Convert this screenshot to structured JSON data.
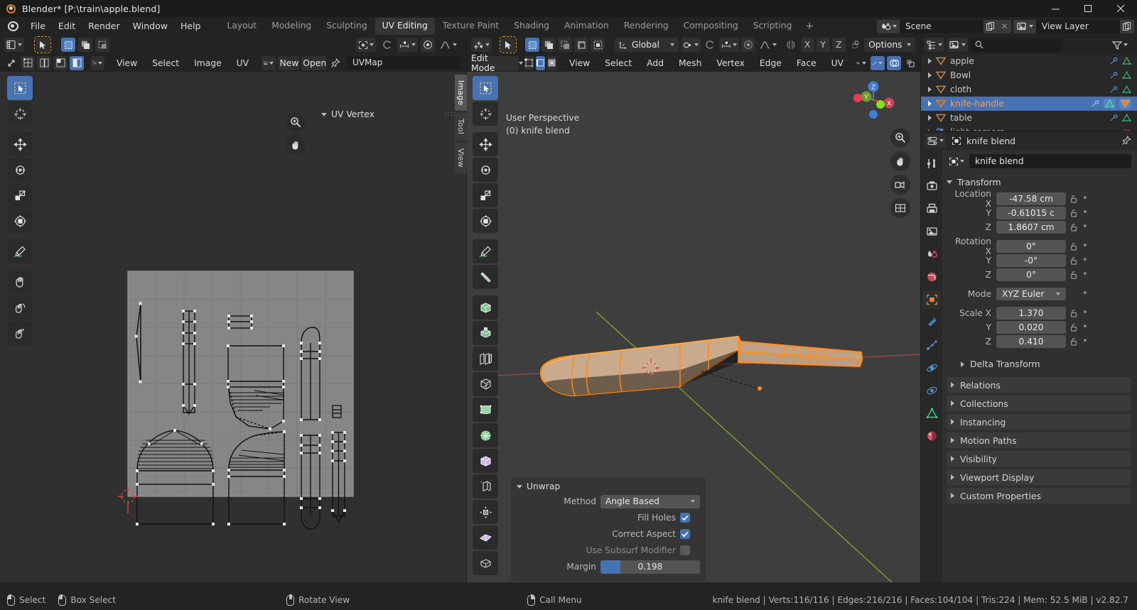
{
  "window": {
    "title": "Blender* [P:\\train\\apple.blend]",
    "icon": "blender-logo-icon",
    "controls": {
      "minimize": "minimize-icon",
      "maximize": "maximize-icon",
      "close": "close-icon"
    }
  },
  "topbar": {
    "menus": [
      "File",
      "Edit",
      "Render",
      "Window",
      "Help"
    ],
    "workspaces": [
      {
        "label": "Layout",
        "active": false
      },
      {
        "label": "Modeling",
        "active": false
      },
      {
        "label": "Sculpting",
        "active": false
      },
      {
        "label": "UV Editing",
        "active": true
      },
      {
        "label": "Texture Paint",
        "active": false
      },
      {
        "label": "Shading",
        "active": false
      },
      {
        "label": "Animation",
        "active": false
      },
      {
        "label": "Rendering",
        "active": false
      },
      {
        "label": "Compositing",
        "active": false
      },
      {
        "label": "Scripting",
        "active": false
      }
    ],
    "add_workspace": "+",
    "scene": {
      "label": "Scene",
      "icon": "scene-icon"
    },
    "view_layer": {
      "label": "View Layer",
      "icon": "view-layer-icon"
    }
  },
  "uv_editor": {
    "menus": [
      "View",
      "Select",
      "Image",
      "UV"
    ],
    "new_button": "New",
    "open_button": "Open",
    "image_name": "UVMap",
    "transform_orientation": "",
    "panel": {
      "title": "UV Vertex"
    },
    "side_tabs": [
      "Image",
      "Tool",
      "View"
    ],
    "tools": [
      "tweak-select-tool",
      "cursor-tool",
      "move-tool",
      "rotate-tool",
      "scale-tool",
      "transform-tool",
      "annotate-tool",
      "grab-uv-tool",
      "relax-uv-tool",
      "pinch-uv-tool"
    ]
  },
  "viewport": {
    "mode": "Edit Mode",
    "menus": [
      "View",
      "Select",
      "Add",
      "Mesh",
      "Vertex",
      "Edge",
      "Face",
      "UV"
    ],
    "transform_orientation": "Global",
    "options_label": "Options",
    "axis_toggles": [
      "X",
      "Y",
      "Z"
    ],
    "overlay_text_1": "User Perspective",
    "overlay_text_2": "(0) knife blend",
    "gizmo_axes": {
      "x": "X",
      "y": "Y",
      "z": "Z"
    },
    "tools": [
      "tweak-select-tool",
      "cursor-tool",
      "move-tool",
      "rotate-tool",
      "scale-tool",
      "transform-tool",
      "annotate-tool",
      "measure-tool",
      "add-cube-tool",
      "extrude-region-tool",
      "inset-faces-tool",
      "bevel-tool",
      "loop-cut-tool",
      "knife-tool",
      "poly-build-tool",
      "spin-tool",
      "smooth-tool",
      "edge-slide-tool",
      "shrink-fatten-tool",
      "shear-tool",
      "rip-region-tool"
    ]
  },
  "operator_panel": {
    "title": "Unwrap",
    "method_label": "Method",
    "method_value": "Angle Based",
    "fill_holes_label": "Fill Holes",
    "fill_holes": true,
    "correct_aspect_label": "Correct Aspect",
    "correct_aspect": true,
    "use_subsurf_label": "Use Subsurf Modifier",
    "use_subsurf": false,
    "margin_label": "Margin",
    "margin_value": "0.198",
    "margin_fraction": 0.198
  },
  "outliner": {
    "search_placeholder": "",
    "display_mode_icon": "view-layer-icon",
    "filter_icon": "filter-icon",
    "items": [
      {
        "name": "apple",
        "selected": false
      },
      {
        "name": "Bowl",
        "selected": false
      },
      {
        "name": "cloth",
        "selected": false
      },
      {
        "name": "knife-handle",
        "selected": true
      },
      {
        "name": "table",
        "selected": false
      },
      {
        "name": "light-camera",
        "selected": false
      }
    ]
  },
  "properties": {
    "breadcrumb_object": "knife blend",
    "object_name": "knife blend",
    "tabs": [
      "tool-tab",
      "render-tab",
      "output-tab",
      "view-layer-tab",
      "scene-tab",
      "world-tab",
      "object-tab",
      "modifiers-tab",
      "particles-tab",
      "physics-tab",
      "constraints-tab",
      "data-tab",
      "material-tab"
    ],
    "active_tab_index": 6,
    "transform": {
      "title": "Transform",
      "rows": [
        {
          "label": "Location X",
          "value": "-47.58 cm"
        },
        {
          "label": "Y",
          "value": "-0.61015 c"
        },
        {
          "label": "Z",
          "value": "1.8607 cm"
        }
      ],
      "rotation": [
        {
          "label": "Rotation X",
          "value": "0°"
        },
        {
          "label": "Y",
          "value": "-0°"
        },
        {
          "label": "Z",
          "value": "0°"
        }
      ],
      "mode_label": "Mode",
      "mode_value": "XYZ Euler",
      "scale": [
        {
          "label": "Scale X",
          "value": "1.370"
        },
        {
          "label": "Y",
          "value": "0.020"
        },
        {
          "label": "Z",
          "value": "0.410"
        }
      ],
      "delta_transform": "Delta Transform"
    },
    "sections": [
      "Relations",
      "Collections",
      "Instancing",
      "Motion Paths",
      "Visibility",
      "Viewport Display",
      "Custom Properties"
    ]
  },
  "statusbar": {
    "hints": [
      {
        "icon": "mouse-left-icon",
        "label": "Select"
      },
      {
        "icon": "mouse-left-drag-icon",
        "label": "Box Select"
      },
      {
        "icon": "mouse-middle-icon",
        "label": "Rotate View"
      },
      {
        "icon": "mouse-right-icon",
        "label": "Call Menu"
      }
    ],
    "stats": "knife blend | Verts:116/116 | Edges:216/216 | Faces:104/104 | Tris:224 | Mem: 52.5 MiB | v2.82.7"
  },
  "colors": {
    "accent_blue": "#4772b3",
    "active_orange": "#e87d0d",
    "selected_orange": "#ff9b4a",
    "header_bg": "#232323",
    "editor_bg": "#303030",
    "viewport_bg": "#3d3d3d",
    "mesh_fill": "#c8a98c",
    "axis_x": "#c04a4a",
    "axis_y": "#7fa82b"
  }
}
